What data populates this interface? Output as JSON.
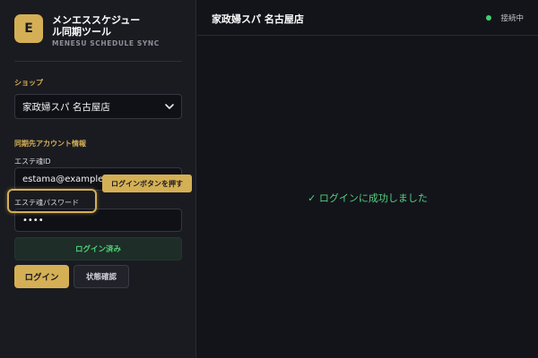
{
  "app": {
    "logo_letter": "E",
    "title": "メンエススケジュール同期ツール",
    "subtitle": "MENESU SCHEDULE SYNC"
  },
  "shop": {
    "label": "ショップ",
    "selected": "家政婦スパ 名古屋店"
  },
  "account": {
    "section_label": "同期先アカウント情報",
    "id_label": "エステ魂ID",
    "id_value": "estama@example.com",
    "password_label": "エステ魂パスワード",
    "password_value": "••••"
  },
  "status": {
    "logged_in": "ログイン済み"
  },
  "buttons": {
    "login": "ログイン",
    "check_status": "状態確認"
  },
  "tooltip": {
    "text": "ログインボタンを押す"
  },
  "header": {
    "shop_name": "家政婦スパ 名古屋店",
    "connection": "接続中"
  },
  "main": {
    "message": "✓ ログインに成功しました"
  },
  "colors": {
    "accent": "#d4af55",
    "success": "#52d27c",
    "connected_dot": "#3fcf6e",
    "background": "#13141a",
    "sidebar": "#1a1b21"
  }
}
